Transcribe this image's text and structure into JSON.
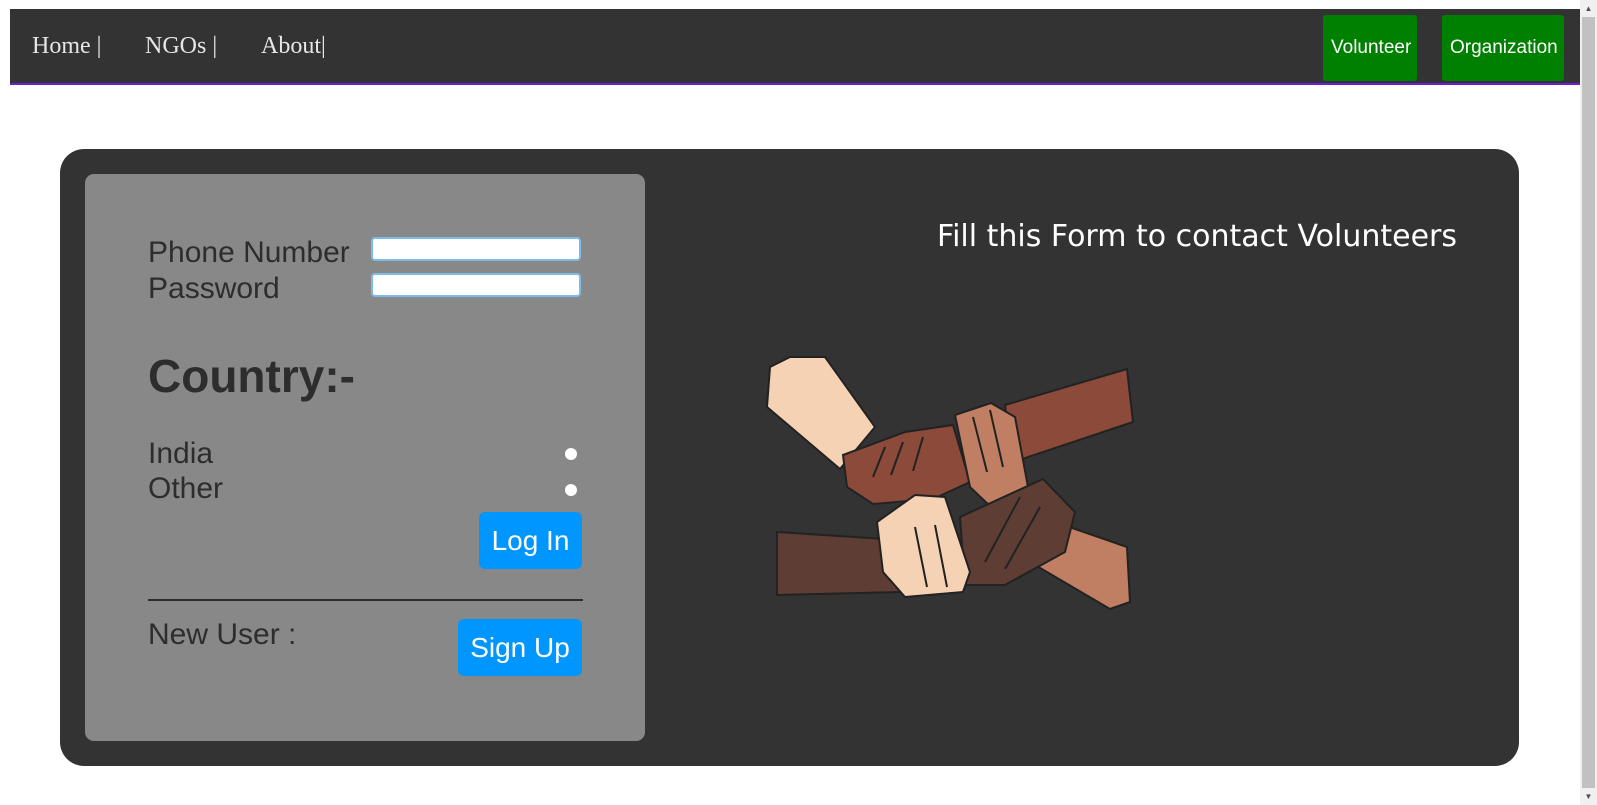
{
  "nav": {
    "links": [
      {
        "label": "Home |"
      },
      {
        "label": "NGOs |"
      },
      {
        "label": "About|"
      }
    ],
    "buttons": {
      "volunteer": "Volunteer",
      "organization": "Organization"
    }
  },
  "login_form": {
    "phone_label": "Phone Number",
    "phone_value": "",
    "password_label": "Password",
    "password_value": "",
    "country_heading": "Country:-",
    "country_options": [
      "India",
      "Other"
    ],
    "login_button": "Log In",
    "new_user_label": "New User :",
    "signup_button": "Sign Up"
  },
  "hero": {
    "tagline": "Fill this Form to contact Volunteers",
    "image_icon": "united-hands-illustration"
  },
  "colors": {
    "nav_bg": "#333333",
    "nav_accent": "#6a1fd6",
    "nav_button": "#008000",
    "card_bg": "#333333",
    "panel_bg": "#888888",
    "primary_button": "#0096ff"
  }
}
